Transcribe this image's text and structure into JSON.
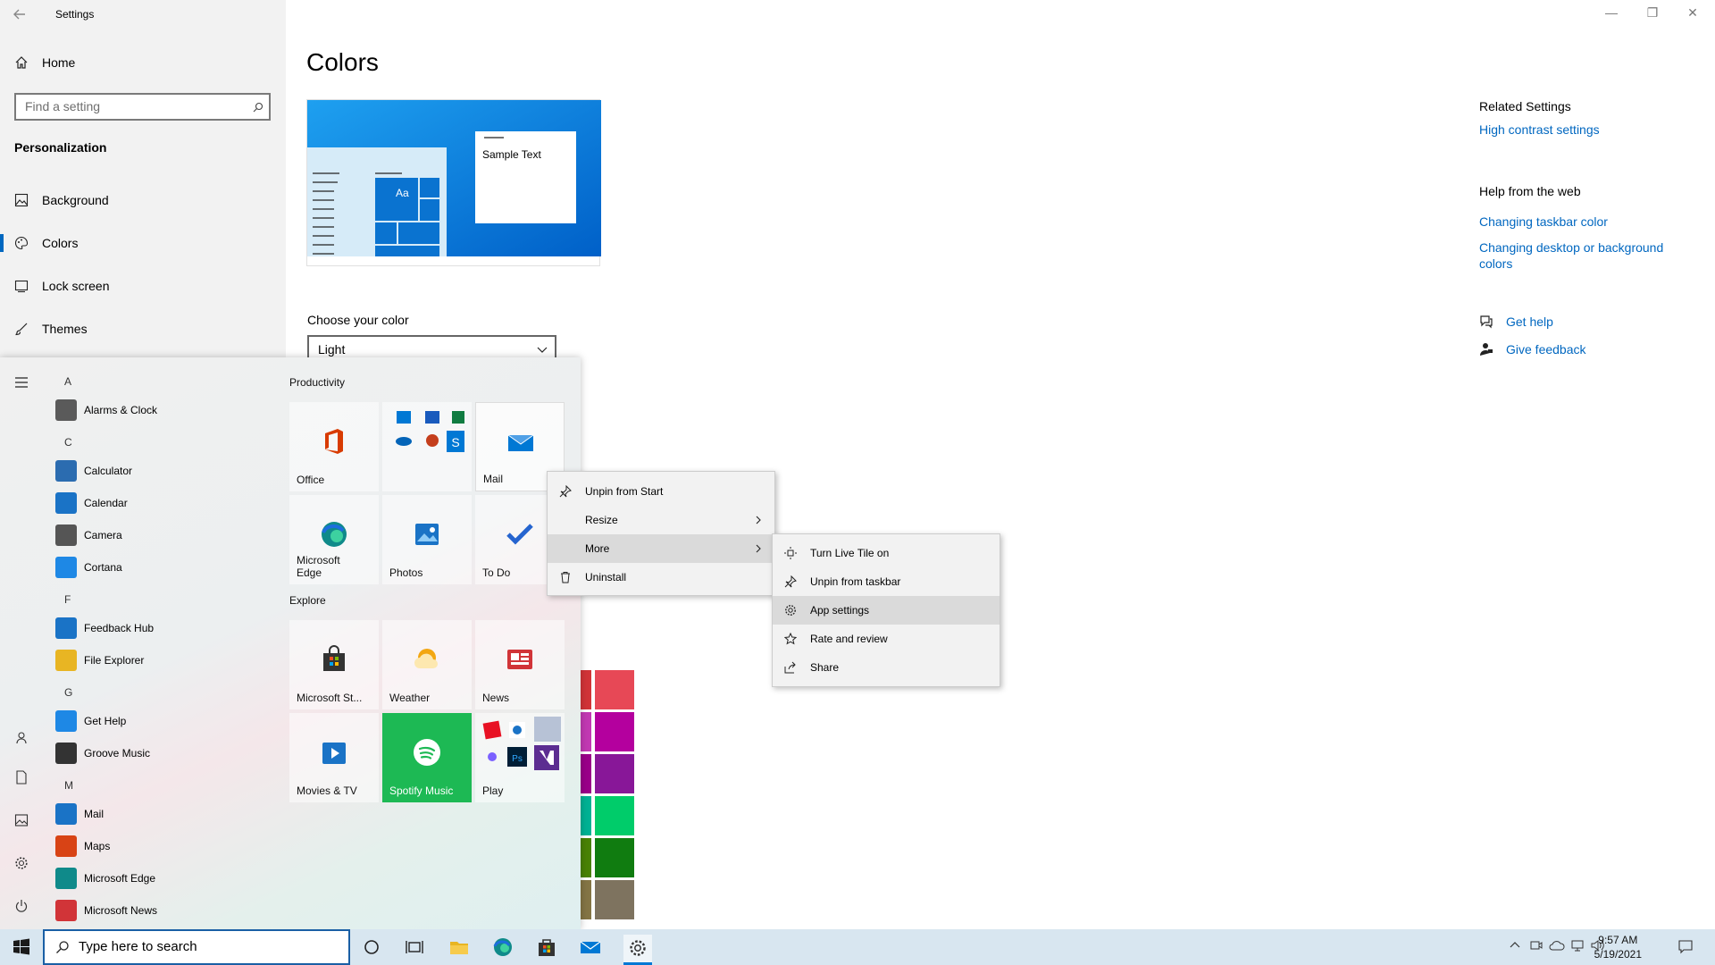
{
  "window": {
    "title": "Settings"
  },
  "sidebar": {
    "home": "Home",
    "search_placeholder": "Find a setting",
    "section": "Personalization",
    "items": [
      {
        "label": "Background",
        "icon": "picture-icon"
      },
      {
        "label": "Colors",
        "icon": "palette-icon",
        "selected": true
      },
      {
        "label": "Lock screen",
        "icon": "lock-screen-icon"
      },
      {
        "label": "Themes",
        "icon": "brush-icon"
      }
    ]
  },
  "main": {
    "title": "Colors",
    "preview_text": "Sample Text",
    "preview_tile_text": "Aa",
    "choose_label": "Choose your color",
    "choose_value": "Light"
  },
  "related": {
    "heading": "Related Settings",
    "link": "High contrast settings",
    "web_heading": "Help from the web",
    "web_links": [
      "Changing taskbar color",
      "Changing desktop or background colors"
    ],
    "get_help": "Get help",
    "feedback": "Give feedback"
  },
  "swatch_colors": [
    "#e74856",
    "#b4009e",
    "#881798",
    "#00cc6a",
    "#107c10",
    "#7e735f"
  ],
  "start_menu": {
    "apps": [
      {
        "type": "letter",
        "text": "A"
      },
      {
        "type": "app",
        "text": "Alarms & Clock",
        "color": "#5a5a5a",
        "icon": "clock-icon"
      },
      {
        "type": "letter",
        "text": "C"
      },
      {
        "type": "app",
        "text": "Calculator",
        "color": "#2b6cb0",
        "icon": "calculator-icon"
      },
      {
        "type": "app",
        "text": "Calendar",
        "color": "#1a73c6",
        "icon": "calendar-icon"
      },
      {
        "type": "app",
        "text": "Camera",
        "color": "#555",
        "icon": "camera-icon"
      },
      {
        "type": "app",
        "text": "Cortana",
        "color": "#1e88e5",
        "icon": "cortana-icon"
      },
      {
        "type": "letter",
        "text": "F"
      },
      {
        "type": "app",
        "text": "Feedback Hub",
        "color": "#1a73c6",
        "icon": "feedback-hub-icon"
      },
      {
        "type": "app",
        "text": "File Explorer",
        "color": "#e8b523",
        "icon": "folder-icon"
      },
      {
        "type": "letter",
        "text": "G"
      },
      {
        "type": "app",
        "text": "Get Help",
        "color": "#1e88e5",
        "icon": "get-help-icon"
      },
      {
        "type": "app",
        "text": "Groove Music",
        "color": "#333",
        "icon": "groove-music-icon"
      },
      {
        "type": "letter",
        "text": "M"
      },
      {
        "type": "app",
        "text": "Mail",
        "color": "#1a73c6",
        "icon": "mail-icon"
      },
      {
        "type": "app",
        "text": "Maps",
        "color": "#d84315",
        "icon": "maps-icon"
      },
      {
        "type": "app",
        "text": "Microsoft Edge",
        "color": "#0f8a8a",
        "icon": "edge-icon"
      },
      {
        "type": "app",
        "text": "Microsoft News",
        "color": "#d13438",
        "icon": "news-icon"
      }
    ],
    "groups": [
      "Productivity",
      "Explore"
    ],
    "tiles": [
      {
        "label": "Office",
        "icon": "office-icon",
        "color": "#d83b01"
      },
      {
        "label": "",
        "icon": "office-apps-folder-icon",
        "color": "#0078d4"
      },
      {
        "label": "Mail",
        "icon": "mail-icon",
        "color": "#0078d4"
      },
      {
        "label": "Microsoft Edge",
        "icon": "edge-icon",
        "color": "#0f8a8a"
      },
      {
        "label": "Photos",
        "icon": "photos-icon",
        "color": "#1a73c6"
      },
      {
        "label": "To Do",
        "icon": "todo-icon",
        "color": "#2564cf"
      },
      {
        "label": "Microsoft St...",
        "icon": "store-icon",
        "color": "#333"
      },
      {
        "label": "Weather",
        "icon": "weather-icon",
        "color": "#f3a712"
      },
      {
        "label": "News",
        "icon": "news-icon",
        "color": "#d13438"
      },
      {
        "label": "Movies & TV",
        "icon": "movies-icon",
        "color": "#1a73c6"
      },
      {
        "label": "Spotify Music",
        "icon": "spotify-icon",
        "color": "#1db954"
      },
      {
        "label": "Play",
        "icon": "play-folder-icon",
        "color": "#e81123"
      }
    ]
  },
  "context_menu": {
    "items": [
      "Unpin from Start",
      "Resize",
      "More",
      "Uninstall"
    ],
    "submenu": [
      "Turn Live Tile on",
      "Unpin from taskbar",
      "App settings",
      "Rate and review",
      "Share"
    ]
  },
  "taskbar": {
    "search_placeholder": "Type here to search",
    "time": "9:57 AM",
    "date": "5/19/2021"
  }
}
